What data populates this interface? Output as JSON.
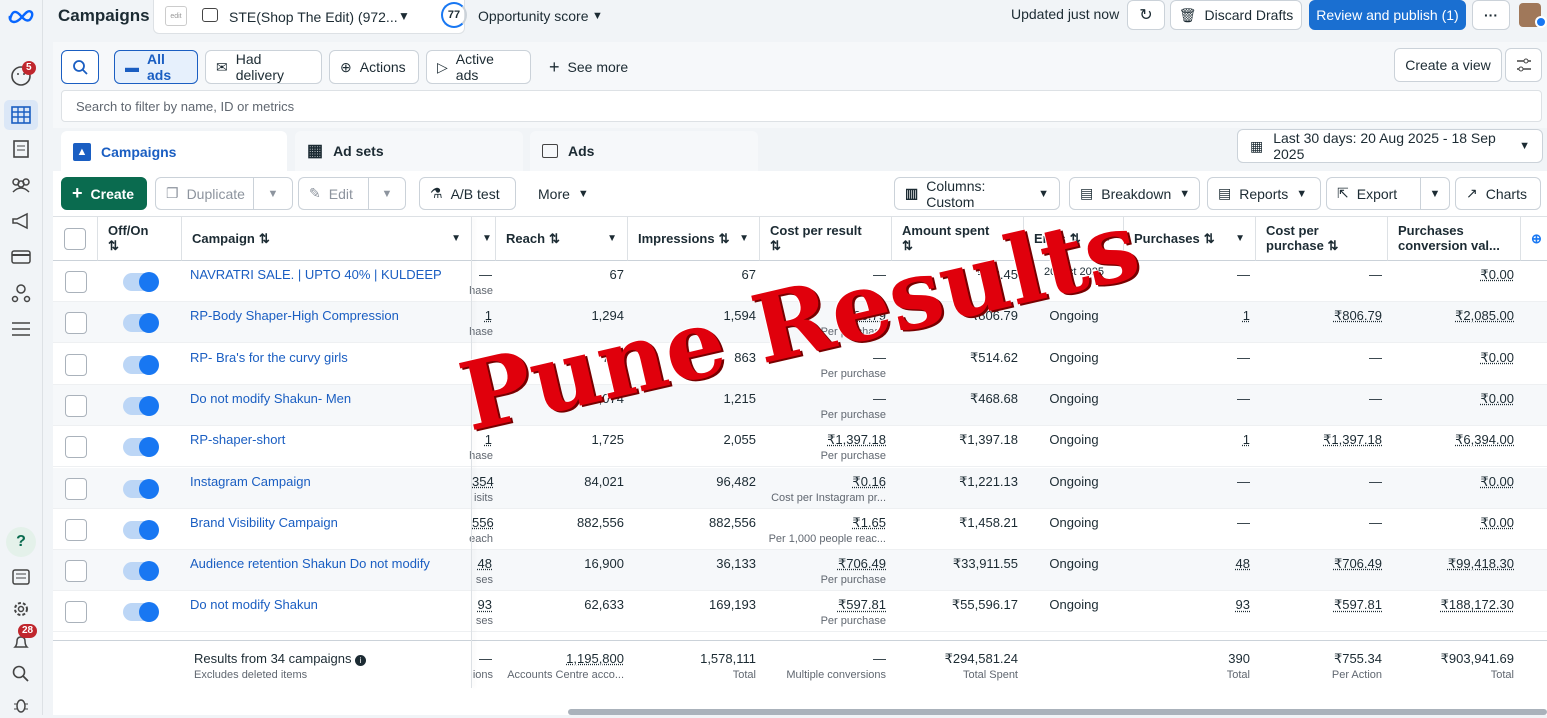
{
  "header": {
    "title": "Campaigns",
    "account": "STE(Shop The Edit) (972...",
    "opportunity_score": "77",
    "opportunity_label": "Opportunity score",
    "updated": "Updated just now",
    "discard": "Discard Drafts",
    "review": "Review and publish (1)",
    "more": "···"
  },
  "rail": {
    "notif_badge": "5",
    "alerts_badge": "28"
  },
  "filters": {
    "all_ads": "All ads",
    "had_delivery": "Had delivery",
    "actions": "Actions",
    "active_ads": "Active ads",
    "see_more": "See more",
    "create_view": "Create a view",
    "search_placeholder": "Search to filter by name, ID or metrics"
  },
  "tabs": {
    "campaigns": "Campaigns",
    "ad_sets": "Ad sets",
    "ads": "Ads",
    "date_range": "Last 30 days: 20 Aug 2025 - 18 Sep 2025"
  },
  "toolbar": {
    "create": "Create",
    "duplicate": "Duplicate",
    "edit": "Edit",
    "ab_test": "A/B test",
    "more": "More",
    "columns": "Columns: Custom",
    "breakdown": "Breakdown",
    "reports": "Reports",
    "export": "Export",
    "charts": "Charts"
  },
  "columns": {
    "offon": "Off/On",
    "campaign": "Campaign",
    "reach": "Reach",
    "impressions": "Impressions",
    "cost_per_result": "Cost per result",
    "amount_spent": "Amount spent",
    "ends": "Ends",
    "purchases": "Purchases",
    "cost_per_purchase_1": "Cost per",
    "cost_per_purchase_2": "purchase",
    "purchases_value_1": "Purchases",
    "purchases_value_2": "conversion val..."
  },
  "rows": [
    {
      "name": "NAVRATRI SALE. | UPTO 40% | KULDEEP",
      "res": "—",
      "res_sub": "hase",
      "reach": "67",
      "impr": "67",
      "cpr": "—",
      "cpr_sub": "",
      "spent": "₹23.45",
      "ends": "20 Oct 2025",
      "purch": "—",
      "cpp": "—",
      "pval": "₹0.00"
    },
    {
      "name": "RP-Body Shaper-High Compression",
      "res": "1",
      "res_sub": "hase",
      "reach": "1,294",
      "impr": "1,594",
      "cpr": "₹806.79",
      "cpr_sub": "Per purchase",
      "spent": "₹806.79",
      "ends": "Ongoing",
      "purch": "1",
      "cpp": "₹806.79",
      "pval": "₹2,085.00"
    },
    {
      "name": "RP- Bra's for the curvy girls",
      "res": "—",
      "res_sub": "",
      "reach": "753",
      "impr": "863",
      "cpr": "—",
      "cpr_sub": "Per purchase",
      "spent": "₹514.62",
      "ends": "Ongoing",
      "purch": "—",
      "cpp": "—",
      "pval": "₹0.00"
    },
    {
      "name": "Do not modify Shakun- Men",
      "res": "—",
      "res_sub": "na",
      "reach": "1,074",
      "impr": "1,215",
      "cpr": "—",
      "cpr_sub": "Per purchase",
      "spent": "₹468.68",
      "ends": "Ongoing",
      "purch": "—",
      "cpp": "—",
      "pval": "₹0.00"
    },
    {
      "name": "RP-shaper-short",
      "res": "1",
      "res_sub": "hase",
      "reach": "1,725",
      "impr": "2,055",
      "cpr": "₹1,397.18",
      "cpr_sub": "Per purchase",
      "spent": "₹1,397.18",
      "ends": "Ongoing",
      "purch": "1",
      "cpp": "₹1,397.18",
      "pval": "₹6,394.00"
    },
    {
      "name": "Instagram Campaign",
      "res": "354",
      "res_sub": "isits",
      "reach": "84,021",
      "impr": "96,482",
      "cpr": "₹0.16",
      "cpr_sub": "Cost per Instagram pr...",
      "spent": "₹1,221.13",
      "ends": "Ongoing",
      "purch": "—",
      "cpp": "—",
      "pval": "₹0.00"
    },
    {
      "name": "Brand Visibility Campaign",
      "res": "556",
      "res_sub": "each",
      "reach": "882,556",
      "impr": "882,556",
      "cpr": "₹1.65",
      "cpr_sub": "Per 1,000 people reac...",
      "spent": "₹1,458.21",
      "ends": "Ongoing",
      "purch": "—",
      "cpp": "—",
      "pval": "₹0.00"
    },
    {
      "name": "Audience retention Shakun Do not modify",
      "res": "48",
      "res_sub": "ses",
      "reach": "16,900",
      "impr": "36,133",
      "cpr": "₹706.49",
      "cpr_sub": "Per purchase",
      "spent": "₹33,911.55",
      "ends": "Ongoing",
      "purch": "48",
      "cpp": "₹706.49",
      "pval": "₹99,418.30"
    },
    {
      "name": "Do not modify Shakun",
      "res": "93",
      "res_sub": "ses",
      "reach": "62,633",
      "impr": "169,193",
      "cpr": "₹597.81",
      "cpr_sub": "Per purchase",
      "spent": "₹55,596.17",
      "ends": "Ongoing",
      "purch": "93",
      "cpp": "₹597.81",
      "pval": "₹188,172.30"
    }
  ],
  "footer": {
    "results": "Results from 34 campaigns",
    "excludes": "Excludes deleted items",
    "res_sub": "ions",
    "res": "—",
    "reach": "1,195,800",
    "reach_sub": "Accounts Centre acco...",
    "impr": "1,578,111",
    "impr_sub": "Total",
    "cpr": "—",
    "cpr_sub": "Multiple conversions",
    "spent": "₹294,581.24",
    "spent_sub": "Total Spent",
    "purch": "390",
    "purch_sub": "Total",
    "cpp": "₹755.34",
    "cpp_sub": "Per Action",
    "pval": "₹903,941.69",
    "pval_sub": "Total"
  },
  "watermark": "Pune Results",
  "colors": {
    "accent": "#1877f2",
    "create_green": "#0a6b4f",
    "badge_red": "#c0262d",
    "watermark": "#e0000c"
  }
}
